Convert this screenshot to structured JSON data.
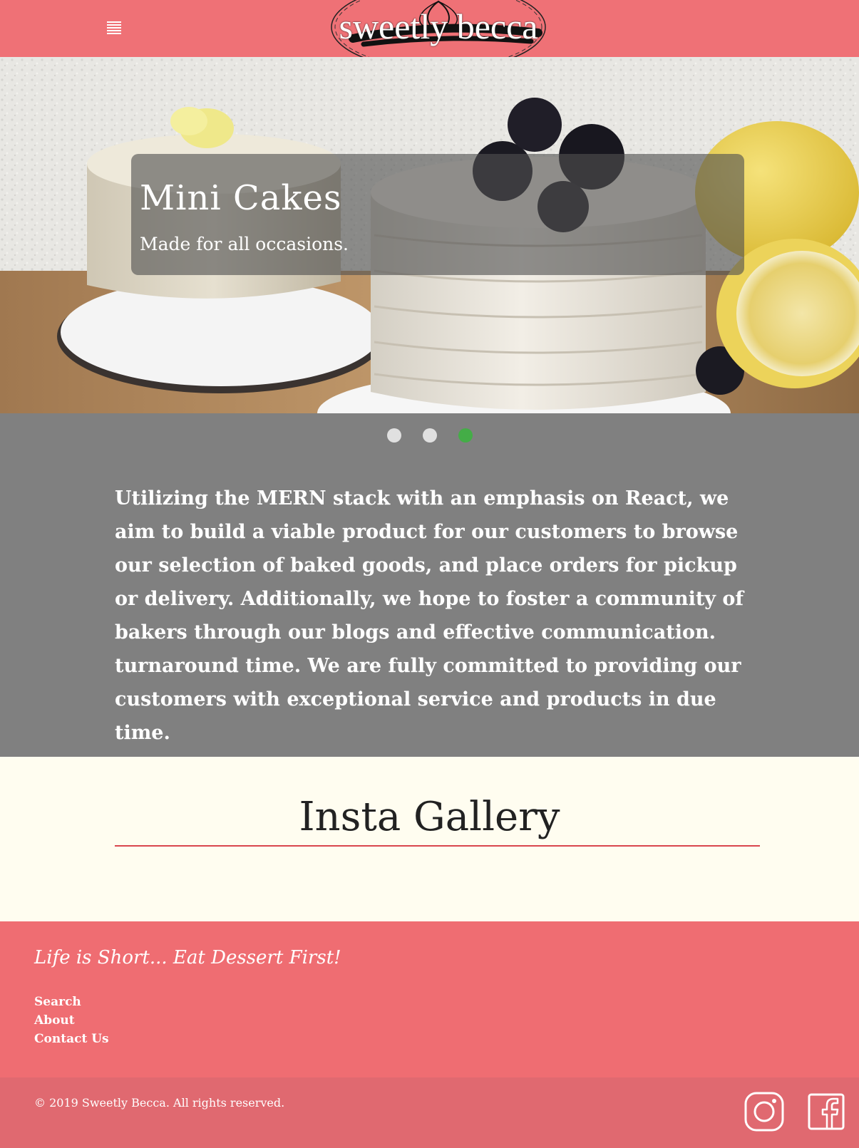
{
  "navbar": {
    "brand": "sweetly becca",
    "menu_icon": "hamburger-menu-icon"
  },
  "hero": {
    "title": "Mini Cakes",
    "subtitle": "Made for all occasions.",
    "slides": 3,
    "active_slide": 3
  },
  "about": {
    "text": "Utilizing the MERN stack with an emphasis on React, we aim to build a viable product for our customers to browse our selection of baked goods, and place orders for pickup or delivery. Additionally, we hope to foster a community of bakers through our blogs and effective communication. turnaround time. We are fully committed to providing our customers with exceptional service and products in due time."
  },
  "gallery": {
    "title": "Insta Gallery"
  },
  "footer": {
    "tagline": "Life is Short... Eat Dessert First!",
    "links": [
      "Search",
      "About",
      "Contact Us"
    ],
    "copyright": "© 2019 Sweetly Becca. All rights reserved.",
    "social": [
      "instagram-icon",
      "facebook-icon"
    ]
  },
  "colors": {
    "brand_pink": "#ef7176",
    "footer_pink": "#ef6d72",
    "bottom_bar": "#e06970",
    "gray_band": "#808080",
    "active_dot": "#44ad47",
    "cream": "#fffdf0",
    "gallery_rule": "#d9454d"
  }
}
